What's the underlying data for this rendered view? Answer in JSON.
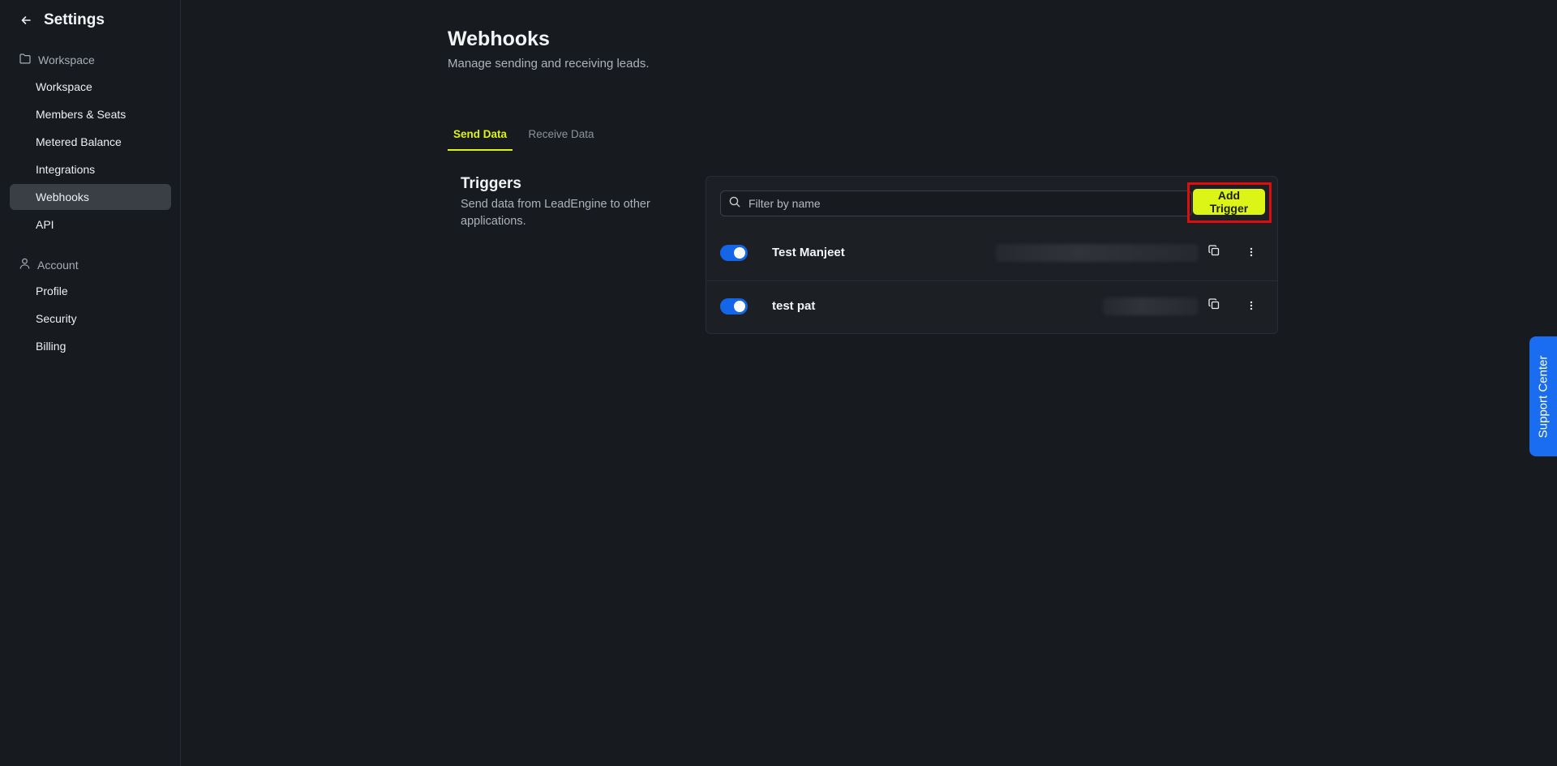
{
  "sidebar": {
    "title": "Settings",
    "sections": [
      {
        "label": "Workspace",
        "icon": "folder-icon",
        "items": [
          {
            "label": "Workspace"
          },
          {
            "label": "Members & Seats"
          },
          {
            "label": "Metered Balance"
          },
          {
            "label": "Integrations"
          },
          {
            "label": "Webhooks",
            "active": true
          },
          {
            "label": "API"
          }
        ]
      },
      {
        "label": "Account",
        "icon": "user-icon",
        "items": [
          {
            "label": "Profile"
          },
          {
            "label": "Security"
          },
          {
            "label": "Billing"
          }
        ]
      }
    ]
  },
  "page": {
    "title": "Webhooks",
    "subtitle": "Manage sending and receiving leads."
  },
  "tabs": [
    {
      "label": "Send Data",
      "active": true
    },
    {
      "label": "Receive Data",
      "active": false
    }
  ],
  "triggers": {
    "title": "Triggers",
    "description": "Send data from LeadEngine to other applications.",
    "search_placeholder": "Filter by name",
    "add_button": "Add Trigger",
    "rows": [
      {
        "name": "Test Manjeet",
        "enabled": true,
        "url_blurred": true
      },
      {
        "name": "test pat",
        "enabled": true,
        "url_blurred": true
      }
    ]
  },
  "support": {
    "label": "Support Center"
  },
  "colors": {
    "background": "#171a1e",
    "accent": "#dcf516",
    "toggle_on": "#1565e8",
    "support_tab": "#1a6df0",
    "highlight_border": "#e10d0d"
  }
}
